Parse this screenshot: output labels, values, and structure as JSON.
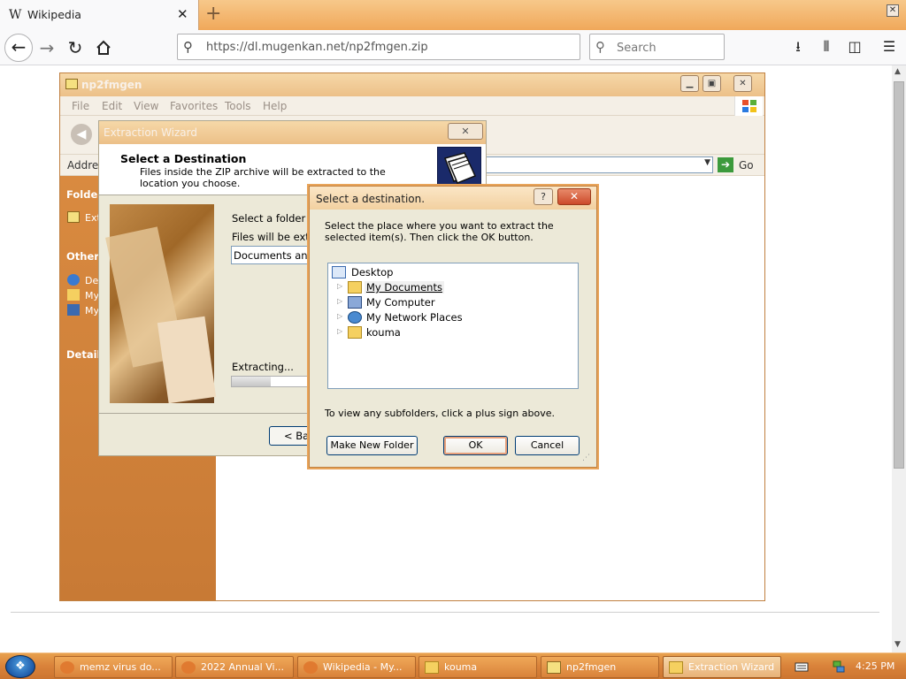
{
  "browser": {
    "tab_title": "Wikipedia",
    "tab_favicon": "W",
    "url": "https://dl.mugenkan.net/np2fmgen.zip",
    "search_placeholder": "Search"
  },
  "explorer": {
    "title": "np2fmgen",
    "menu": [
      "File",
      "Edit",
      "View",
      "Favorites",
      "Tools",
      "Help"
    ],
    "address_label": "Address",
    "go_label": "Go",
    "sidebar": {
      "folder_heading": "Folder",
      "folder_item": "Ext",
      "other_heading": "Other",
      "other_items": [
        "De",
        "My",
        "My"
      ],
      "details_heading": "Details"
    }
  },
  "wizard": {
    "title": "Extraction Wizard",
    "header_title": "Select a Destination",
    "header_desc": "Files inside the ZIP archive will be extracted to the location you choose.",
    "select_folder_label": "Select a folder to e",
    "files_extracted_label": "Files will be extract",
    "destination_value": "Documents and S",
    "extracting_label": "Extracting...",
    "progress": 0.45,
    "back_button": "< Back"
  },
  "browse_dialog": {
    "title": "Select a destination.",
    "instructions": "Select the place where you want to extract the selected item(s).  Then click the OK button.",
    "tree": {
      "root": "Desktop",
      "children": [
        "My Documents",
        "My Computer",
        "My Network Places",
        "kouma"
      ],
      "selected": "My Documents"
    },
    "hint": "To view any subfolders, click a plus sign above.",
    "make_new_folder": "Make New Folder",
    "ok": "OK",
    "cancel": "Cancel"
  },
  "taskbar": {
    "tasks": [
      {
        "label": "memz virus do...",
        "icon": "firefox-icon",
        "active": false
      },
      {
        "label": "2022 Annual Vi...",
        "icon": "firefox-icon",
        "active": false
      },
      {
        "label": "Wikipedia - My...",
        "icon": "firefox-icon",
        "active": false
      },
      {
        "label": "kouma",
        "icon": "folder-icon",
        "active": false
      },
      {
        "label": "np2fmgen",
        "icon": "zip-folder-icon",
        "active": false
      },
      {
        "label": "Extraction Wizard",
        "icon": "folder-icon",
        "active": true
      }
    ],
    "clock": "4:25 PM"
  },
  "colors": {
    "tabbar_gradient": "#f0a85a",
    "sidepanel": "#d98a40",
    "taskbar": "#d9823a",
    "dialog_face": "#ece9d8"
  }
}
